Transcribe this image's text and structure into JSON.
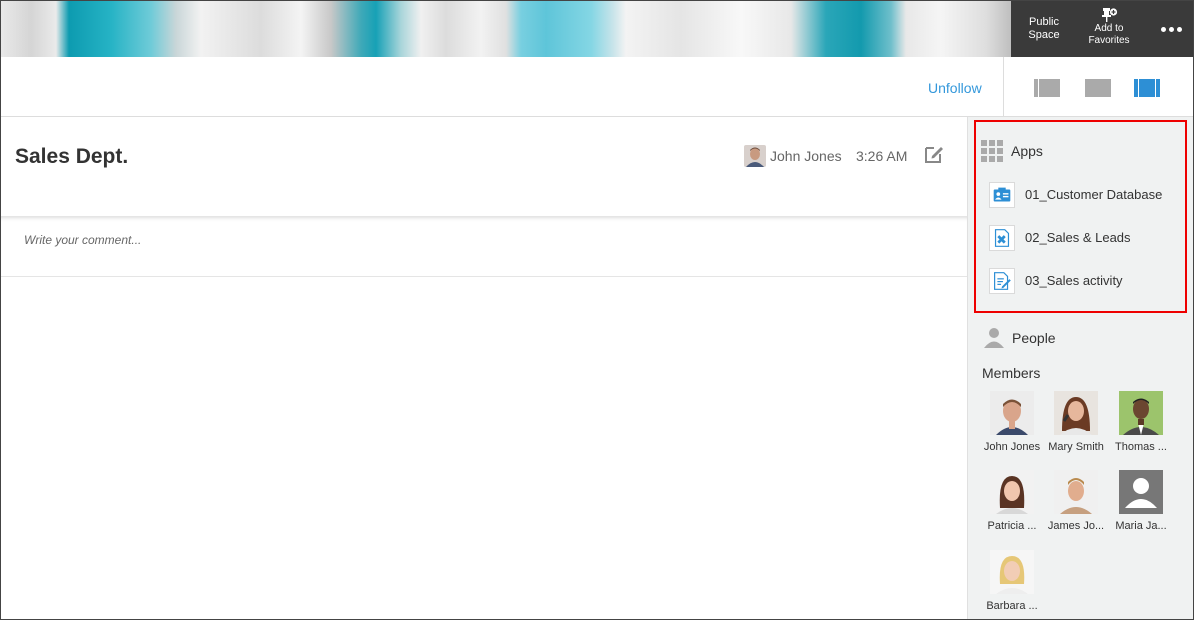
{
  "header": {
    "public_space": "Public\nSpace",
    "public_space_line1": "Public",
    "public_space_line2": "Space",
    "add_fav_line1": "Add to",
    "add_fav_line2": "Favorites",
    "more_icon": "ellipsis-icon"
  },
  "toolbar": {
    "unfollow": "Unfollow"
  },
  "thread": {
    "title": "Sales Dept.",
    "author": "John Jones",
    "time": "3:26 AM",
    "comment_placeholder": "Write your comment..."
  },
  "sidebar": {
    "apps_label": "Apps",
    "apps": [
      {
        "label": "01_Customer Database",
        "icon": "contact-card-icon"
      },
      {
        "label": "02_Sales & Leads",
        "icon": "leads-doc-icon"
      },
      {
        "label": "03_Sales activity",
        "icon": "activity-doc-icon"
      }
    ],
    "people_label": "People",
    "members_label": "Members",
    "members": [
      {
        "name": "John Jones"
      },
      {
        "name": "Mary Smith"
      },
      {
        "name": "Thomas ..."
      },
      {
        "name": "Patricia ..."
      },
      {
        "name": "James Jo..."
      },
      {
        "name": "Maria Ja..."
      },
      {
        "name": "Barbara ..."
      }
    ]
  },
  "colors": {
    "accent": "#3498db",
    "highlight_border": "#e00000",
    "header_dark": "#3a3a3a",
    "sidebar_bg": "#f0f2f2"
  }
}
